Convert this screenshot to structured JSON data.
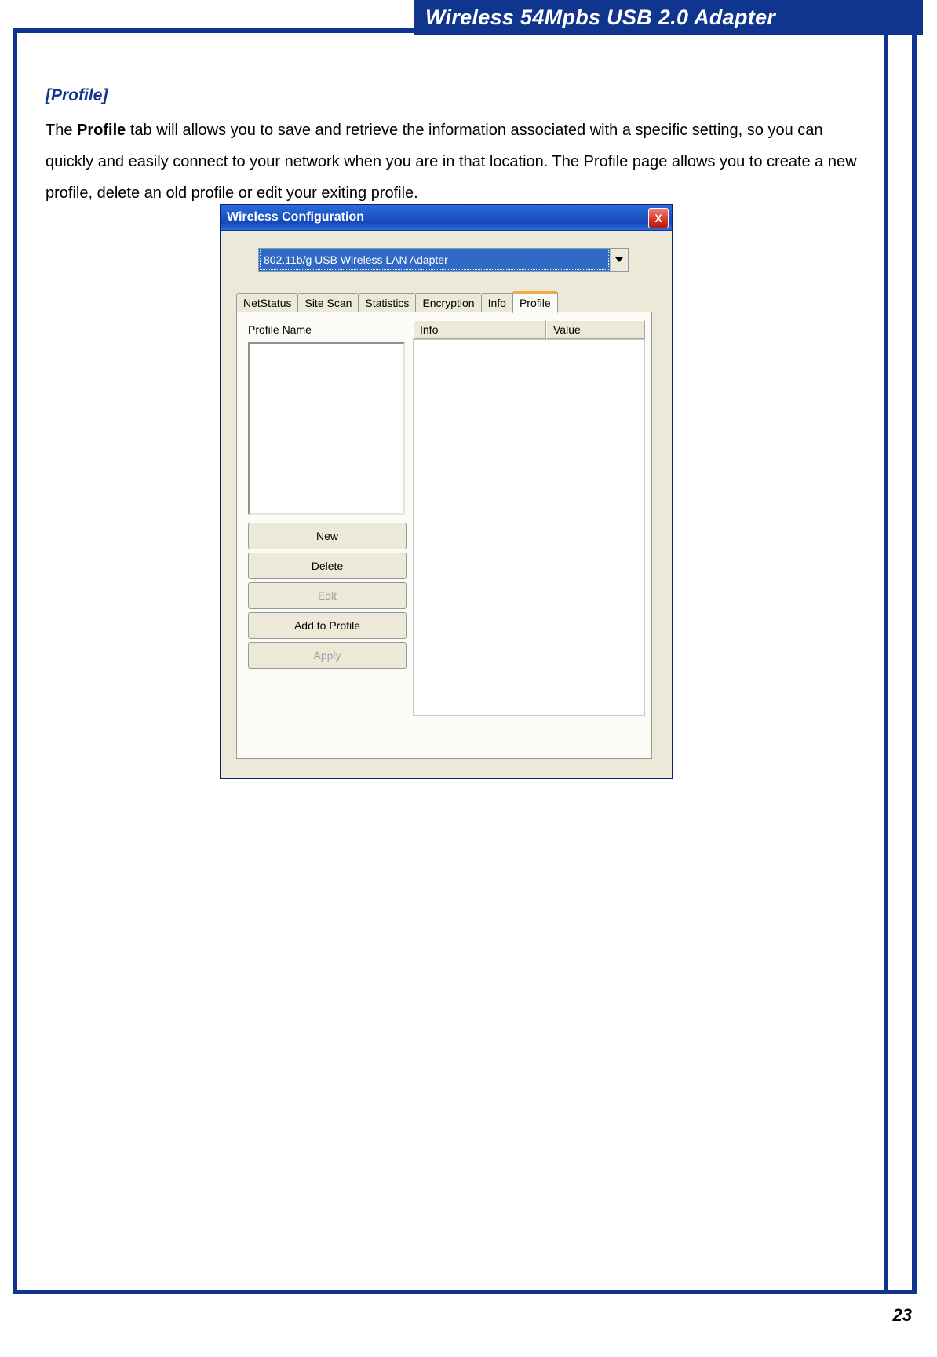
{
  "page": {
    "header_banner": "Wireless 54Mpbs USB 2.0 Adapter",
    "section_title": "[Profile]",
    "para_lead": "The ",
    "para_bold": "Profile",
    "para_rest": " tab will allows you to save and retrieve the information associated with a specific setting, so you can quickly and easily connect to your network when you are in that location. The Profile page allows you to create a new profile, delete an old profile or edit your exiting profile.",
    "page_number": "23"
  },
  "win": {
    "title": "Wireless Configuration",
    "close_label": "X",
    "adapter_selected": "802.11b/g USB Wireless LAN Adapter",
    "tabs": {
      "netstatus": "NetStatus",
      "sitescan": "Site Scan",
      "statistics": "Statistics",
      "encryption": "Encryption",
      "info": "Info",
      "profile": "Profile"
    },
    "labels": {
      "profile_name": "Profile Name",
      "info_col": "Info",
      "value_col": "Value"
    },
    "buttons": {
      "new": "New",
      "delete": "Delete",
      "edit": "Edit",
      "add": "Add to Profile",
      "apply": "Apply"
    }
  }
}
